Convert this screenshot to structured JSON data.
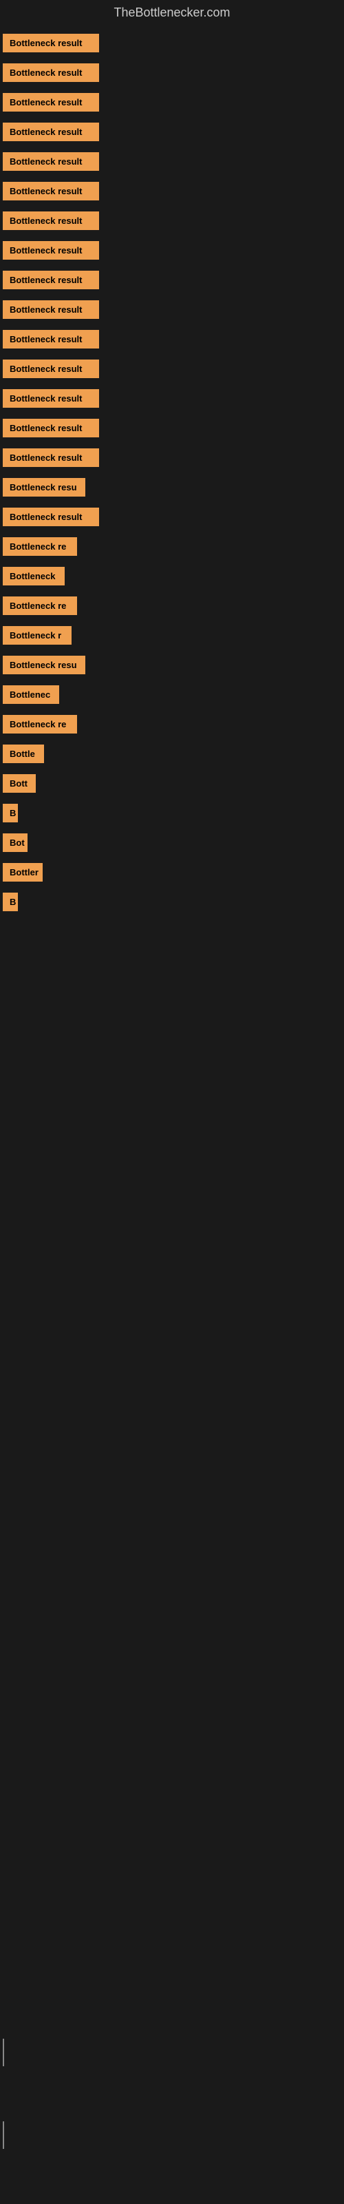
{
  "header": {
    "title": "TheBottlenecker.com"
  },
  "items": [
    {
      "label": "Bottleneck result",
      "width": 140
    },
    {
      "label": "Bottleneck result",
      "width": 140
    },
    {
      "label": "Bottleneck result",
      "width": 140
    },
    {
      "label": "Bottleneck result",
      "width": 140
    },
    {
      "label": "Bottleneck result",
      "width": 140
    },
    {
      "label": "Bottleneck result",
      "width": 140
    },
    {
      "label": "Bottleneck result",
      "width": 140
    },
    {
      "label": "Bottleneck result",
      "width": 140
    },
    {
      "label": "Bottleneck result",
      "width": 140
    },
    {
      "label": "Bottleneck result",
      "width": 140
    },
    {
      "label": "Bottleneck result",
      "width": 140
    },
    {
      "label": "Bottleneck result",
      "width": 140
    },
    {
      "label": "Bottleneck result",
      "width": 140
    },
    {
      "label": "Bottleneck result",
      "width": 140
    },
    {
      "label": "Bottleneck result",
      "width": 140
    },
    {
      "label": "Bottleneck resu",
      "width": 120
    },
    {
      "label": "Bottleneck result",
      "width": 140
    },
    {
      "label": "Bottleneck re",
      "width": 108
    },
    {
      "label": "Bottleneck",
      "width": 90
    },
    {
      "label": "Bottleneck re",
      "width": 108
    },
    {
      "label": "Bottleneck r",
      "width": 100
    },
    {
      "label": "Bottleneck resu",
      "width": 120
    },
    {
      "label": "Bottlenec",
      "width": 82
    },
    {
      "label": "Bottleneck re",
      "width": 108
    },
    {
      "label": "Bottle",
      "width": 60
    },
    {
      "label": "Bott",
      "width": 48
    },
    {
      "label": "B",
      "width": 22
    },
    {
      "label": "Bot",
      "width": 36
    },
    {
      "label": "Bottler",
      "width": 58
    },
    {
      "label": "B",
      "width": 22
    }
  ],
  "colors": {
    "badge_bg": "#f0a050",
    "badge_text": "#000000",
    "body_bg": "#1a1a1a",
    "title_color": "#cccccc"
  }
}
